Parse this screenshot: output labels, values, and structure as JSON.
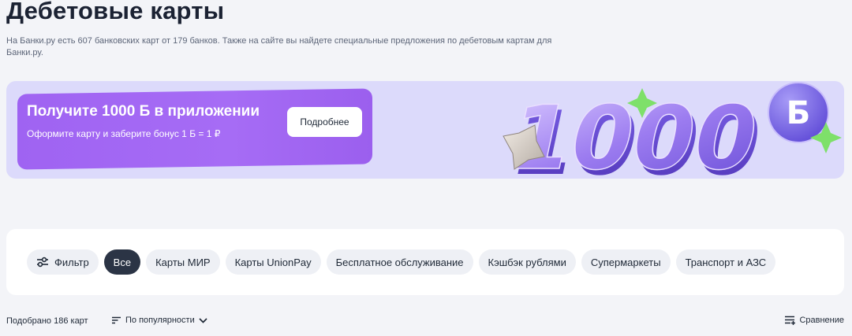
{
  "header": {
    "title": "Дебетовые карты",
    "subtitle": "На Банки.ру есть 607 банковских карт от 179 банков. Также на сайте вы найдете специальные предложения по дебетовым картам для Банки.ру."
  },
  "banner": {
    "title": "Получите 1000 Б в приложении",
    "subtitle": "Оформите карту и заберите бонус 1 Б = 1 ₽",
    "button_label": "Подробнее",
    "art_number": "1000",
    "art_badge": "Б",
    "colors": {
      "background": "#dcdafb",
      "promo": "#a66cf5",
      "accent_green": "#7ee06a"
    }
  },
  "filters": {
    "filter_label": "Фильтр",
    "chips": [
      {
        "label": "Все",
        "active": true
      },
      {
        "label": "Карты МИР",
        "active": false
      },
      {
        "label": "Карты UnionPay",
        "active": false
      },
      {
        "label": "Бесплатное обслуживание",
        "active": false
      },
      {
        "label": "Кэшбэк рублями",
        "active": false
      },
      {
        "label": "Супермаркеты",
        "active": false
      },
      {
        "label": "Транспорт и АЗС",
        "active": false
      }
    ]
  },
  "results": {
    "count_text": "Подобрано 186 карт",
    "sort_label": "По популярности",
    "compare_label": "Сравнение"
  }
}
